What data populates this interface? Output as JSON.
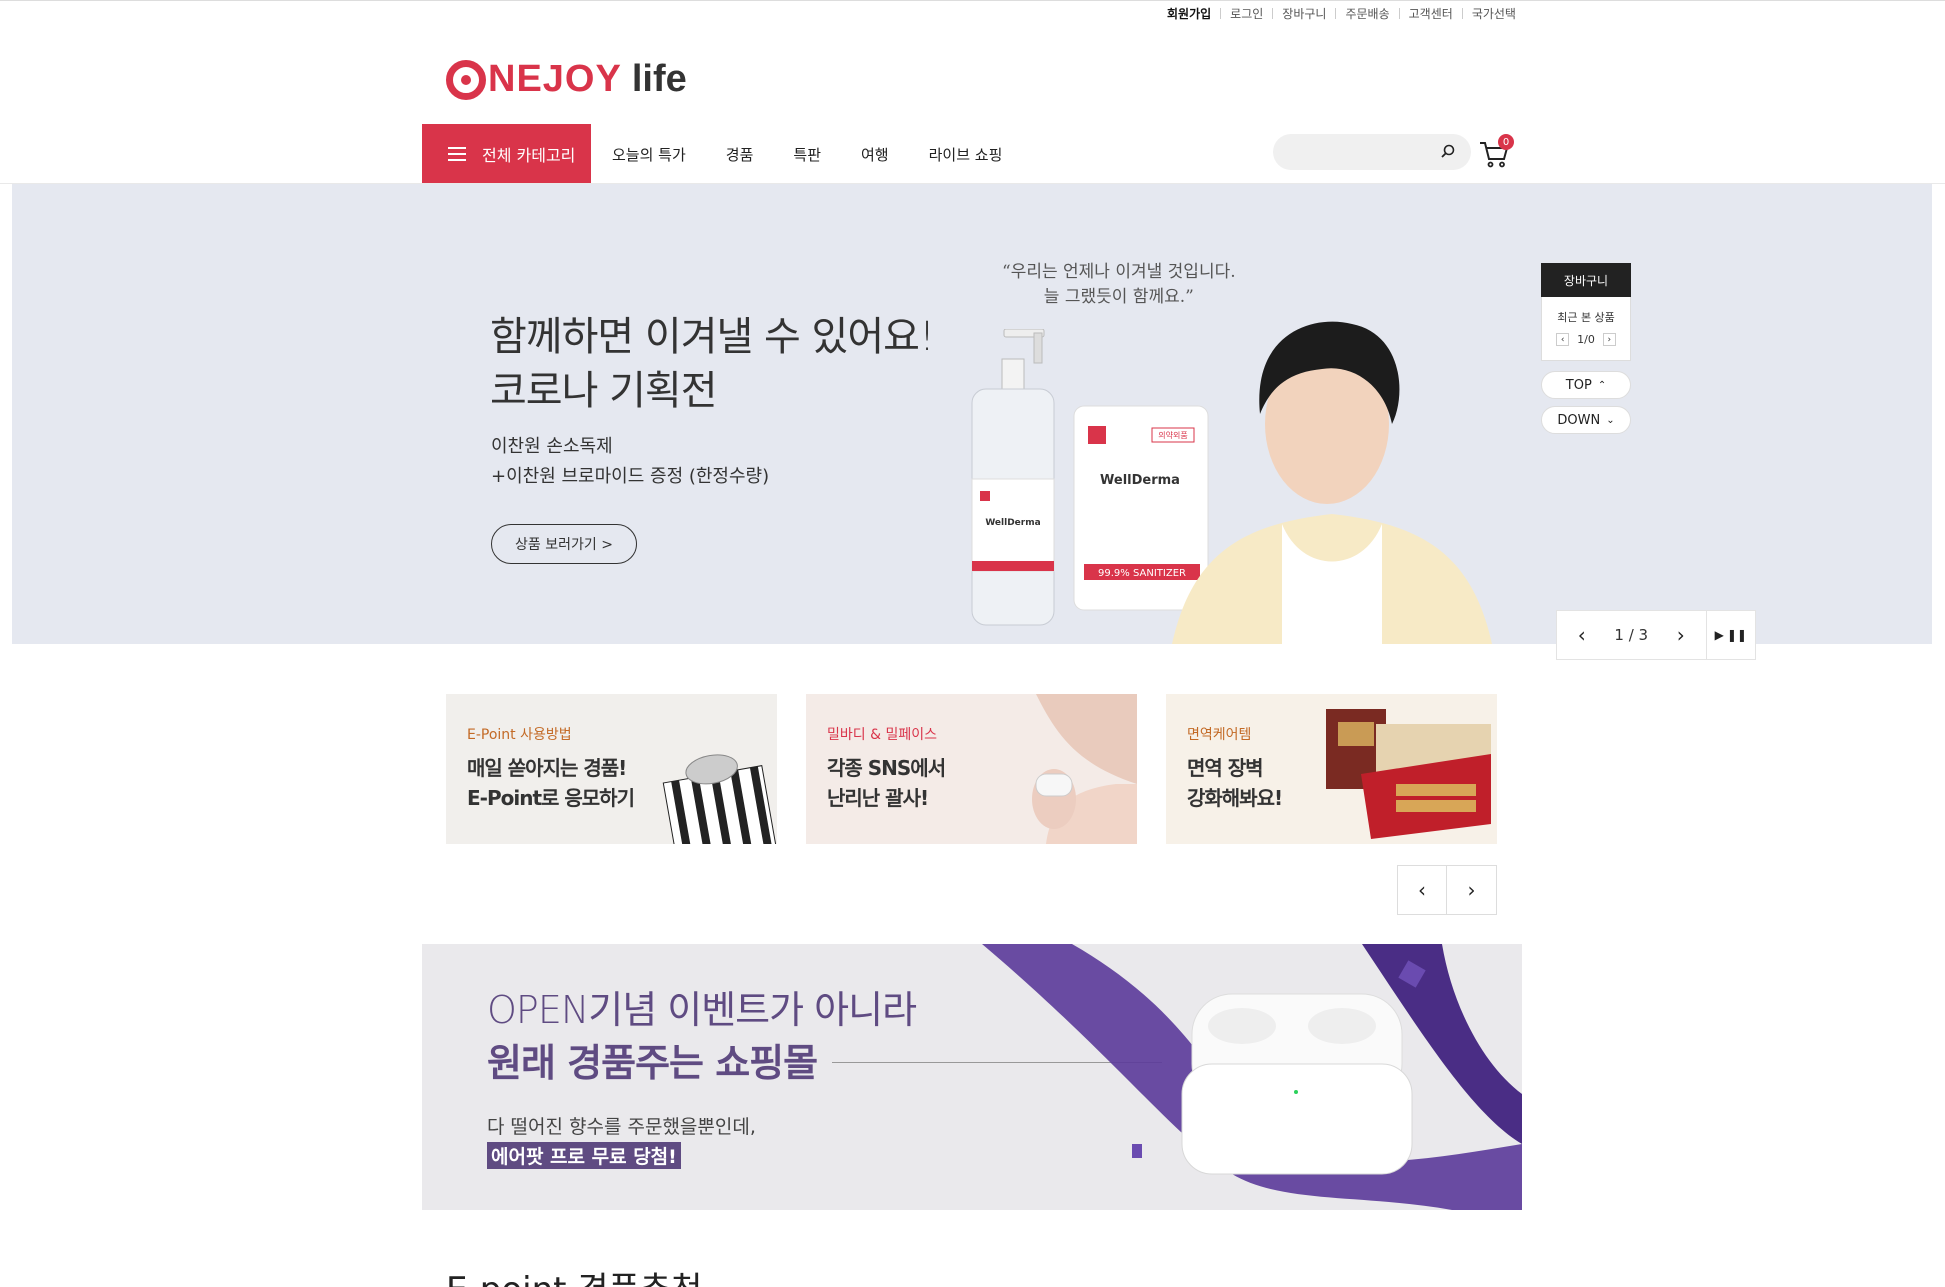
{
  "util_links": [
    "회원가입",
    "로그인",
    "장바구니",
    "주문배송",
    "고객센터",
    "국가선택"
  ],
  "logo": {
    "brand": "NEJOY",
    "suffix": "life"
  },
  "nav": {
    "category_button": "전체 카테고리",
    "menu": [
      "오늘의 특가",
      "경품",
      "특판",
      "여행",
      "라이브 쇼핑"
    ]
  },
  "search": {
    "value": "",
    "placeholder": ""
  },
  "cart": {
    "count": "0"
  },
  "hero": {
    "title_line1": "함께하면 이겨낼 수 있어요!",
    "title_line2": "코로나 기획전",
    "sub_line1": "이찬원 손소독제",
    "sub_line2": "+이찬원 브로마이드 증정 (한정수량)",
    "button": "상품 보러가기 >",
    "quote_line1": "“우리는 언제나 이겨낼 것입니다.",
    "quote_line2": "늘 그랬듯이 함께요.”",
    "product_brand": "WellDerma",
    "product_label": "99.9% SANITIZER",
    "pouch_tag": "의약외품",
    "pager": {
      "current": "1 / 3"
    }
  },
  "side_widget": {
    "cart": "장바구니",
    "recent": "최근 본 상품",
    "pager": "1/0",
    "top": "TOP",
    "down": "DOWN"
  },
  "cards": [
    {
      "tag": "E-Point 사용방법",
      "line1": "매일 쏟아지는 경품!",
      "line2": "E-Point로 응모하기"
    },
    {
      "tag": "밀바디 & 밀페이스",
      "line1": "각종 SNS에서",
      "line2": "난리난 괄사!"
    },
    {
      "tag": "면역케어템",
      "line1": "면역 장벽",
      "line2": "강화해봐요!"
    }
  ],
  "event": {
    "line1": "OPEN기념 이벤트가 아니라",
    "line2": "원래 경품주는 쇼핑몰",
    "line3": "다 떨어진 향수를 주문했을뿐인데,",
    "line4": "에어팟 프로 무료 당첨!"
  },
  "section": {
    "title": "E-point 경품추천"
  },
  "colors": {
    "brand": "#d9344a",
    "event_purple": "#5f4b82",
    "hero_bg": "#e5e8f0"
  }
}
